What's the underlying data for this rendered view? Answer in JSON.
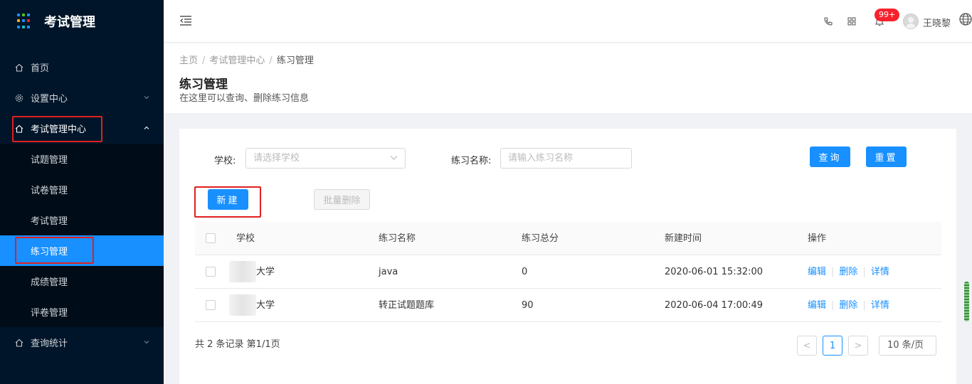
{
  "sidebar": {
    "brand_title": "考试管理",
    "logo_colors": [
      "#1890ff",
      "#52c41a",
      "#1890ff",
      "#faad14",
      "#1890ff",
      "#f5222d",
      "#1890ff",
      "#13c2c2",
      "#1890ff"
    ],
    "items": {
      "home": "首页",
      "settings": "设置中心",
      "exam_center": "考试管理中心",
      "query_stats": "查询统计"
    },
    "submenu": [
      "试题管理",
      "试卷管理",
      "考试管理",
      "练习管理",
      "成绩管理",
      "评卷管理"
    ],
    "active_submenu": "练习管理"
  },
  "header": {
    "badge": "99+",
    "username": "王晓黎",
    "icons": [
      "fold-icon",
      "phone-icon",
      "apps-icon",
      "bell-icon",
      "avatar",
      "globe-icon"
    ]
  },
  "page": {
    "breadcrumb": {
      "home": "主页",
      "parent": "考试管理中心",
      "current": "练习管理"
    },
    "title": "练习管理",
    "description": "在这里可以查询、删除练习信息"
  },
  "filters": {
    "school_label": "学校:",
    "school_placeholder": "请选择学校",
    "name_label": "练习名称:",
    "name_placeholder": "请输入练习名称",
    "query_button": "查询",
    "reset_button": "重置"
  },
  "toolbar": {
    "new_button": "新建",
    "batch_delete_button": "批量删除"
  },
  "table": {
    "columns": [
      "学校",
      "练习名称",
      "练习总分",
      "新建时间",
      "操作"
    ],
    "rows": [
      {
        "school": "大学",
        "name": "java",
        "score": "0",
        "created": "2020-06-01 15:32:00"
      },
      {
        "school": "大学",
        "name": "转正试题题库",
        "score": "90",
        "created": "2020-06-04 17:00:49"
      }
    ],
    "actions": {
      "edit": "编辑",
      "delete": "删除",
      "detail": "详情"
    }
  },
  "pagination": {
    "summary": "共 2 条记录 第1/1页",
    "current_page": "1",
    "prev": "<",
    "next": ">",
    "page_size": "10 条/页"
  }
}
